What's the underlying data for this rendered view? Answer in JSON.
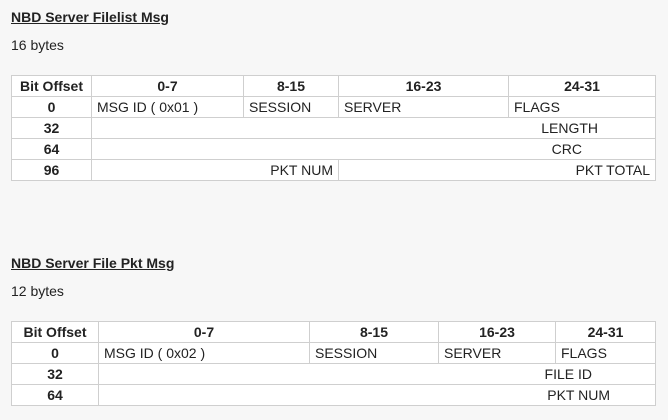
{
  "section1": {
    "title": "NBD Server Filelist Msg",
    "size": "16 bytes",
    "headers": [
      "Bit Offset",
      "0-7",
      "8-15",
      "16-23",
      "24-31"
    ],
    "rows": {
      "r0": {
        "offset": "0",
        "c1": "MSG ID ( 0x01 )",
        "c2": "SESSION",
        "c3": "SERVER",
        "c4": "FLAGS"
      },
      "r32": {
        "offset": "32",
        "span": "LENGTH"
      },
      "r64": {
        "offset": "64",
        "span": "CRC"
      },
      "r96": {
        "offset": "96",
        "left": "PKT NUM",
        "right": "PKT TOTAL"
      }
    }
  },
  "section2": {
    "title": "NBD Server File Pkt Msg",
    "size": "12 bytes",
    "headers": [
      "Bit Offset",
      "0-7",
      "8-15",
      "16-23",
      "24-31"
    ],
    "rows": {
      "r0": {
        "offset": "0",
        "c1": "MSG ID ( 0x02 )",
        "c2": "SESSION",
        "c3": "SERVER",
        "c4": "FLAGS"
      },
      "r32": {
        "offset": "32",
        "span": "FILE ID"
      },
      "r64": {
        "offset": "64",
        "span": "PKT NUM"
      }
    }
  }
}
